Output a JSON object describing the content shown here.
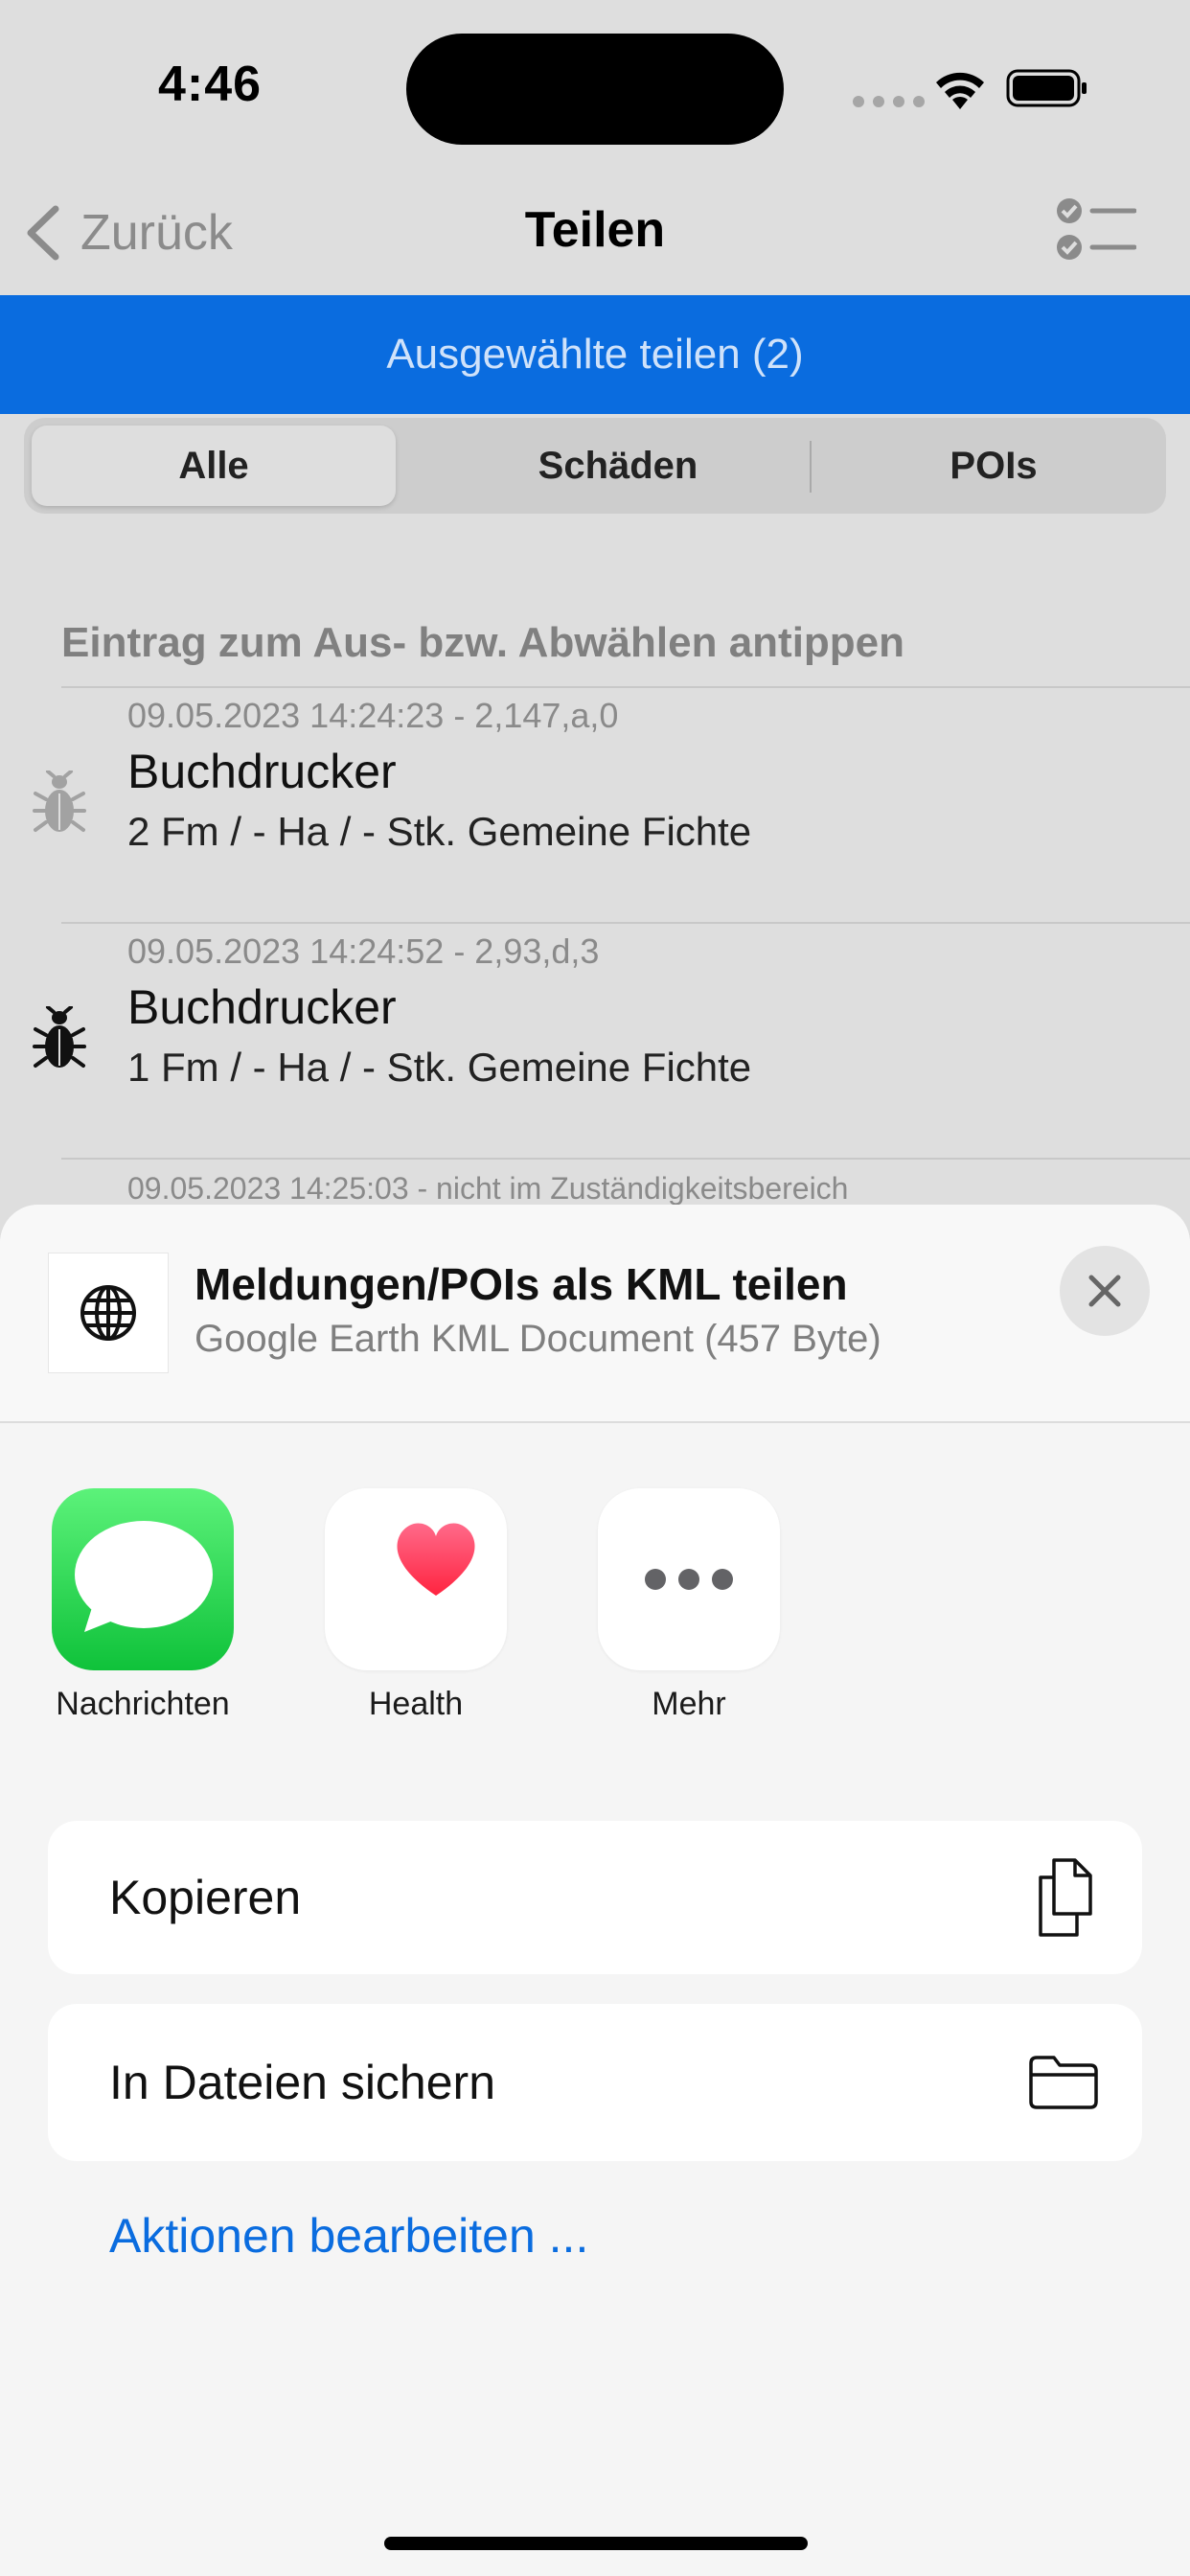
{
  "status": {
    "time": "4:46"
  },
  "nav": {
    "back_label": "Zurück",
    "title": "Teilen",
    "menu_icon": "checklist-icon"
  },
  "share_selected_label": "Ausgewählte teilen (2)",
  "segments": [
    {
      "label": "Alle",
      "selected": true
    },
    {
      "label": "Schäden",
      "selected": false
    },
    {
      "label": "POIs",
      "selected": false
    }
  ],
  "hint": "Eintrag zum Aus- bzw. Abwählen antippen",
  "entries": [
    {
      "meta": "09.05.2023 14:24:23 - 2,147,a,0",
      "name": "Buchdrucker",
      "detail": "2 Fm / - Ha / - Stk. Gemeine Fichte",
      "icon": "bug-icon",
      "selected": false
    },
    {
      "meta": "09.05.2023 14:24:52 - 2,93,d,3",
      "name": "Buchdrucker",
      "detail": "1 Fm / - Ha / - Stk. Gemeine Fichte",
      "icon": "bug-icon",
      "selected": true
    }
  ],
  "entry_peek_meta": "09.05.2023 14:25:03 - nicht im Zuständigkeitsbereich",
  "share_sheet": {
    "title": "Meldungen/POIs als KML teilen",
    "subtitle": "Google Earth KML Document (457 Byte)",
    "apps": [
      {
        "label": "Nachrichten",
        "icon": "messages-icon"
      },
      {
        "label": "Health",
        "icon": "heart-icon"
      },
      {
        "label": "Mehr",
        "icon": "more-icon"
      }
    ],
    "actions": [
      {
        "label": "Kopieren",
        "icon": "copy-icon"
      },
      {
        "label": "In Dateien sichern",
        "icon": "folder-icon"
      }
    ],
    "edit_actions_label": "Aktionen bearbeiten ..."
  },
  "colors": {
    "accent": "#0a6cdf",
    "messages_green": "#1fd14a",
    "health_red": "#ff2d55"
  }
}
